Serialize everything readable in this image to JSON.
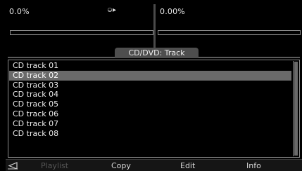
{
  "meters": {
    "left": {
      "percent": "0.0%",
      "progress": 0
    },
    "right": {
      "percent": "0.00%",
      "progress": 0
    }
  },
  "tab": {
    "label": "CD/DVD: Track"
  },
  "tracks": {
    "items": [
      "CD track 01",
      "CD track 02",
      "CD track 03",
      "CD track 04",
      "CD track 05",
      "CD track 06",
      "CD track 07",
      "CD track 08"
    ],
    "selected_index": 1
  },
  "softkeys": {
    "back_icon": "back-triangle-icon",
    "playlist": "Playlist",
    "copy": "Copy",
    "edit": "Edit",
    "info": "Info"
  },
  "icons": {
    "cd_output": "cd-output-icon"
  },
  "colors": {
    "selected_row": "#6a6a6a",
    "tab_bg": "#4e4e4e",
    "background": "#000000"
  }
}
